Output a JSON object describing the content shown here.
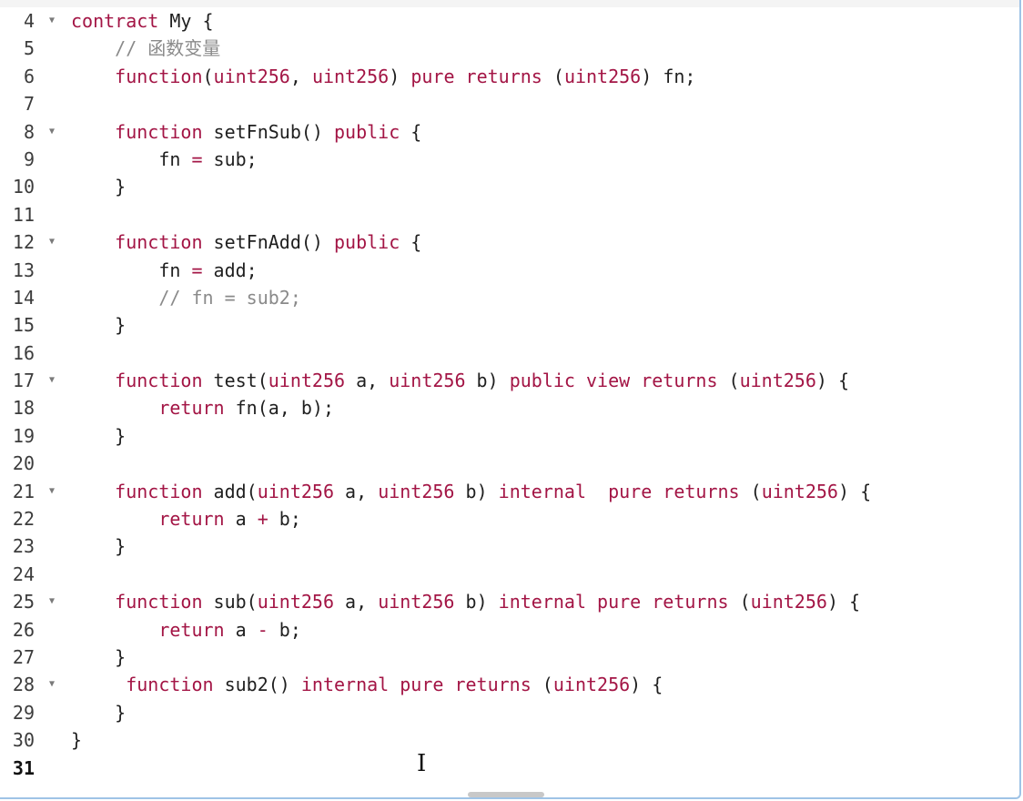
{
  "editor": {
    "fold_glyph": "▼",
    "mouse_cursor_glyph": "I",
    "lines": [
      {
        "num": "4",
        "foldable": true,
        "tokens": [
          [
            "kw",
            "contract"
          ],
          [
            "tx",
            " My {"
          ]
        ]
      },
      {
        "num": "5",
        "foldable": false,
        "tokens": [
          [
            "tx",
            "    "
          ],
          [
            "cm",
            "// 函数变量"
          ]
        ]
      },
      {
        "num": "6",
        "foldable": false,
        "tokens": [
          [
            "tx",
            "    "
          ],
          [
            "kw",
            "function"
          ],
          [
            "tx",
            "("
          ],
          [
            "kw",
            "uint256"
          ],
          [
            "tx",
            ", "
          ],
          [
            "kw",
            "uint256"
          ],
          [
            "tx",
            ") "
          ],
          [
            "kw",
            "pure"
          ],
          [
            "tx",
            " "
          ],
          [
            "kw",
            "returns"
          ],
          [
            "tx",
            " ("
          ],
          [
            "kw",
            "uint256"
          ],
          [
            "tx",
            ") fn;"
          ]
        ]
      },
      {
        "num": "7",
        "foldable": false,
        "tokens": []
      },
      {
        "num": "8",
        "foldable": true,
        "tokens": [
          [
            "tx",
            "    "
          ],
          [
            "kw",
            "function"
          ],
          [
            "tx",
            " setFnSub() "
          ],
          [
            "kw",
            "public"
          ],
          [
            "tx",
            " {"
          ]
        ]
      },
      {
        "num": "9",
        "foldable": false,
        "tokens": [
          [
            "tx",
            "        fn "
          ],
          [
            "kw",
            "="
          ],
          [
            "tx",
            " sub;"
          ]
        ]
      },
      {
        "num": "10",
        "foldable": false,
        "tokens": [
          [
            "tx",
            "    }"
          ]
        ]
      },
      {
        "num": "11",
        "foldable": false,
        "tokens": []
      },
      {
        "num": "12",
        "foldable": true,
        "tokens": [
          [
            "tx",
            "    "
          ],
          [
            "kw",
            "function"
          ],
          [
            "tx",
            " setFnAdd() "
          ],
          [
            "kw",
            "public"
          ],
          [
            "tx",
            " {"
          ]
        ]
      },
      {
        "num": "13",
        "foldable": false,
        "tokens": [
          [
            "tx",
            "        fn "
          ],
          [
            "kw",
            "="
          ],
          [
            "tx",
            " add;"
          ]
        ]
      },
      {
        "num": "14",
        "foldable": false,
        "tokens": [
          [
            "tx",
            "        "
          ],
          [
            "cm",
            "// fn = sub2;"
          ]
        ]
      },
      {
        "num": "15",
        "foldable": false,
        "tokens": [
          [
            "tx",
            "    }"
          ]
        ]
      },
      {
        "num": "16",
        "foldable": false,
        "tokens": []
      },
      {
        "num": "17",
        "foldable": true,
        "tokens": [
          [
            "tx",
            "    "
          ],
          [
            "kw",
            "function"
          ],
          [
            "tx",
            " test("
          ],
          [
            "kw",
            "uint256"
          ],
          [
            "tx",
            " a, "
          ],
          [
            "kw",
            "uint256"
          ],
          [
            "tx",
            " b) "
          ],
          [
            "kw",
            "public"
          ],
          [
            "tx",
            " "
          ],
          [
            "kw",
            "view"
          ],
          [
            "tx",
            " "
          ],
          [
            "kw",
            "returns"
          ],
          [
            "tx",
            " ("
          ],
          [
            "kw",
            "uint256"
          ],
          [
            "tx",
            ") {"
          ]
        ]
      },
      {
        "num": "18",
        "foldable": false,
        "tokens": [
          [
            "tx",
            "        "
          ],
          [
            "kw",
            "return"
          ],
          [
            "tx",
            " fn(a, b);"
          ]
        ]
      },
      {
        "num": "19",
        "foldable": false,
        "tokens": [
          [
            "tx",
            "    }"
          ]
        ]
      },
      {
        "num": "20",
        "foldable": false,
        "tokens": []
      },
      {
        "num": "21",
        "foldable": true,
        "tokens": [
          [
            "tx",
            "    "
          ],
          [
            "kw",
            "function"
          ],
          [
            "tx",
            " add("
          ],
          [
            "kw",
            "uint256"
          ],
          [
            "tx",
            " a, "
          ],
          [
            "kw",
            "uint256"
          ],
          [
            "tx",
            " b) "
          ],
          [
            "kw",
            "internal"
          ],
          [
            "tx",
            "  "
          ],
          [
            "kw",
            "pure"
          ],
          [
            "tx",
            " "
          ],
          [
            "kw",
            "returns"
          ],
          [
            "tx",
            " ("
          ],
          [
            "kw",
            "uint256"
          ],
          [
            "tx",
            ") {"
          ]
        ]
      },
      {
        "num": "22",
        "foldable": false,
        "tokens": [
          [
            "tx",
            "        "
          ],
          [
            "kw",
            "return"
          ],
          [
            "tx",
            " a "
          ],
          [
            "kw",
            "+"
          ],
          [
            "tx",
            " b;"
          ]
        ]
      },
      {
        "num": "23",
        "foldable": false,
        "tokens": [
          [
            "tx",
            "    }"
          ]
        ]
      },
      {
        "num": "24",
        "foldable": false,
        "tokens": []
      },
      {
        "num": "25",
        "foldable": true,
        "tokens": [
          [
            "tx",
            "    "
          ],
          [
            "kw",
            "function"
          ],
          [
            "tx",
            " sub("
          ],
          [
            "kw",
            "uint256"
          ],
          [
            "tx",
            " a, "
          ],
          [
            "kw",
            "uint256"
          ],
          [
            "tx",
            " b) "
          ],
          [
            "kw",
            "internal"
          ],
          [
            "tx",
            " "
          ],
          [
            "kw",
            "pure"
          ],
          [
            "tx",
            " "
          ],
          [
            "kw",
            "returns"
          ],
          [
            "tx",
            " ("
          ],
          [
            "kw",
            "uint256"
          ],
          [
            "tx",
            ") {"
          ]
        ]
      },
      {
        "num": "26",
        "foldable": false,
        "tokens": [
          [
            "tx",
            "        "
          ],
          [
            "kw",
            "return"
          ],
          [
            "tx",
            " a "
          ],
          [
            "kw",
            "-"
          ],
          [
            "tx",
            " b;"
          ]
        ]
      },
      {
        "num": "27",
        "foldable": false,
        "tokens": [
          [
            "tx",
            "    }"
          ]
        ]
      },
      {
        "num": "28",
        "foldable": true,
        "tokens": [
          [
            "tx",
            "     "
          ],
          [
            "kw",
            "function"
          ],
          [
            "tx",
            " sub2() "
          ],
          [
            "kw",
            "internal"
          ],
          [
            "tx",
            " "
          ],
          [
            "kw",
            "pure"
          ],
          [
            "tx",
            " "
          ],
          [
            "kw",
            "returns"
          ],
          [
            "tx",
            " ("
          ],
          [
            "kw",
            "uint256"
          ],
          [
            "tx",
            ") {"
          ]
        ]
      },
      {
        "num": "29",
        "foldable": false,
        "tokens": [
          [
            "tx",
            "    }"
          ]
        ]
      },
      {
        "num": "30",
        "foldable": false,
        "tokens": [
          [
            "tx",
            "}"
          ]
        ]
      },
      {
        "num": "31",
        "foldable": false,
        "active": true,
        "tokens": []
      }
    ]
  }
}
